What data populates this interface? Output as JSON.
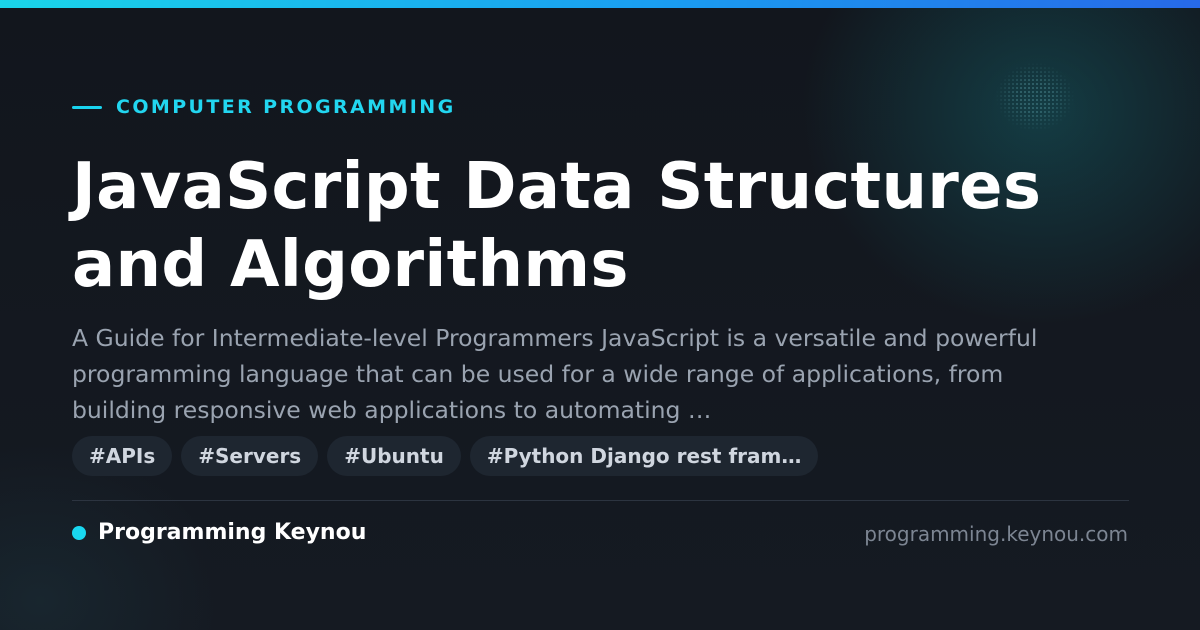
{
  "category": "COMPUTER PROGRAMMING",
  "title": "JavaScript Data Structures and Algorithms",
  "description": "A Guide for Intermediate-level Programmers JavaScript is a versatile and powerful programming language that can be used for a wide range of applications, from building responsive web applications to automating …",
  "tags": [
    "#APIs",
    "#Servers",
    "#Ubuntu",
    "#Python Django rest fram…"
  ],
  "brand": {
    "name": "Programming Keynou",
    "domain": "programming.keynou.com"
  },
  "colors": {
    "background": "#13171e",
    "accent": "#19d3ee",
    "accent_gradient_end": "#2769e8",
    "tag_background": "#1e2630",
    "description_text": "#9aa3b0",
    "domain_text": "#7c8592"
  },
  "icons": {
    "eyebrow": "accent-line-icon",
    "brand": "brand-dot-icon"
  }
}
